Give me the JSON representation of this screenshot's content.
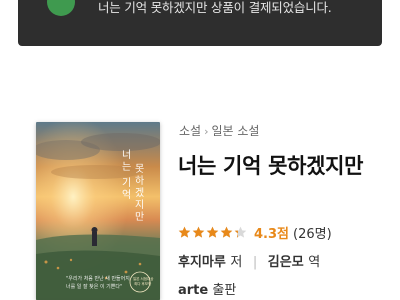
{
  "toast": {
    "message": "너는 기억 못하겠지만 상품이 결제되었습니다.",
    "icon": "check-icon",
    "background": "#2e2e2e",
    "icon_color": "#3f9a4f"
  },
  "breadcrumb": {
    "items": [
      "소설",
      "일본 소설"
    ],
    "separator": "›"
  },
  "book": {
    "title": "너는 기억 못하겠지만",
    "rating": {
      "stars_filled": 4.3,
      "stars_total": 5,
      "score_text": "4.3점",
      "count_text": "(26명)",
      "color": "#e8891a"
    },
    "author": "후지마루",
    "author_role": "저",
    "translator": "김은모",
    "translator_role": "역",
    "publisher": "arte",
    "publisher_role": "출판"
  },
  "cover": {
    "title_vertical": "너는 기억 못하겠지만",
    "tagline": "\"우리가 처음 만난 새 만들어지 너를 일 잘 찾은 이 기쁜다\"",
    "badge": "일본 서점대상 최다 후보작"
  }
}
